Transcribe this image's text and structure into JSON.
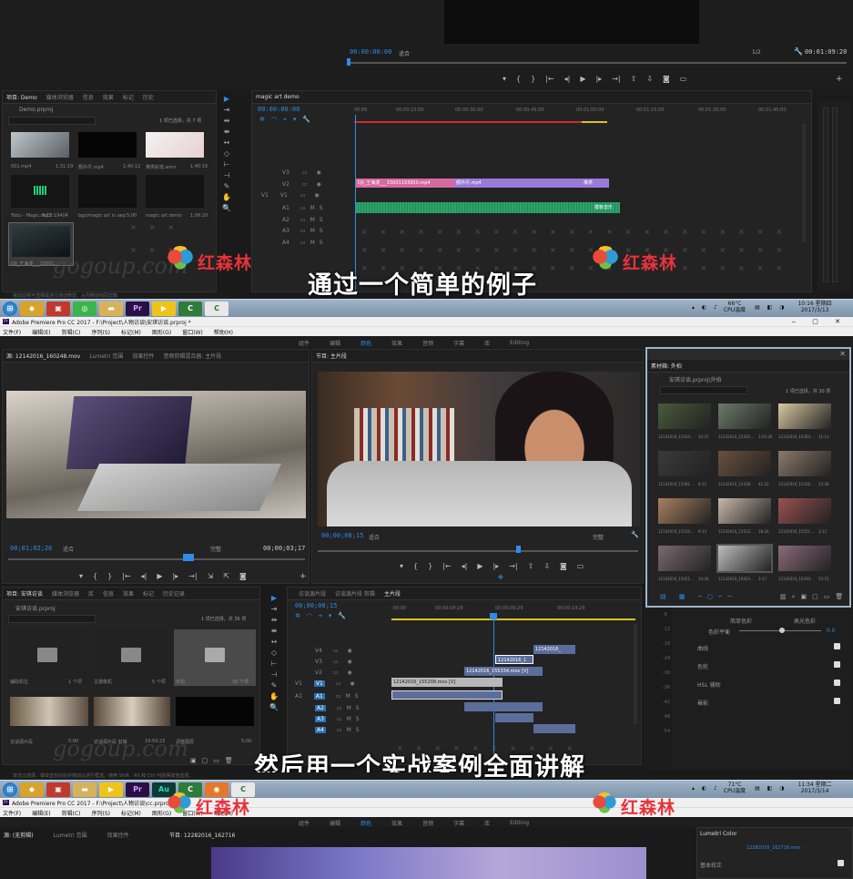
{
  "top": {
    "program_timecode_left": "00:00:00:00",
    "program_fit": "适合",
    "program_scale": "1/2",
    "program_timecode_right": "00:01:09:20",
    "project_tabs": [
      "项目: Demo",
      "媒体浏览器",
      "信息",
      "效果",
      "标记",
      "历史"
    ],
    "project_file": "Demo.prproj",
    "project_count": "1 项已选择，共 7 项",
    "project_items": [
      {
        "name": "001.mp4",
        "dur": "1:31:19"
      },
      {
        "name": "额外尽.mp4",
        "dur": "1:40:12"
      },
      {
        "name": "推类彩谱.wmv",
        "dur": "1:40:15"
      },
      {
        "name": "Tobu - Magic.mp3",
        "dur": "9:13:19404"
      },
      {
        "name": "bgo/magic art in.aep",
        "dur": "5:00"
      },
      {
        "name": "magic art demo",
        "dur": "1:09:20"
      },
      {
        "name": "DJI_王海波___15001...",
        "dur": ""
      }
    ],
    "seq_name": "magic art demo",
    "seq_timecode": "00:00:00:00",
    "ruler": [
      "00:00",
      "00:00:15:00",
      "00:00:30:00",
      "00:00:45:00",
      "00:01:00:00",
      "00:01:15:00",
      "00:01:30:00",
      "00:01:45:00"
    ],
    "tracks": [
      "V3",
      "V2",
      "V1",
      "A1",
      "A2",
      "A3",
      "A4"
    ],
    "clips": [
      "DJI_王海波___15001193950.mp4",
      "额外尽.mp4",
      "推类",
      "模板音乐"
    ],
    "subtitle": "通过一个简单的例子",
    "status": "拖动边缘可选择或进行滚动修改，从而移动线段剪辑"
  },
  "taskbar1": {
    "temp": "66°C",
    "cpu": "CPU温度",
    "time": "10:16 星期四",
    "date": "2017/3/13"
  },
  "mid": {
    "title": "Adobe Premiere Pro CC 2017 - F:\\Project\\人物访谈\\安琪访谈.prproj *",
    "menu": [
      "文件(F)",
      "编辑(E)",
      "剪辑(C)",
      "序列(S)",
      "标记(M)",
      "图形(G)",
      "窗口(W)",
      "帮助(H)"
    ],
    "workspaces": [
      "组件",
      "编辑",
      "颜色",
      "效果",
      "音频",
      "字幕",
      "库",
      "Editing"
    ],
    "source_tabs": [
      "源: 12142016_160248.mov",
      "Lumetri 范围",
      "效果控件",
      "音频剪辑混合器: 主片段"
    ],
    "source_tc": "00;01;02;26",
    "source_fit": "适合",
    "source_quality": "完整",
    "source_tc_right": "00;00;03;17",
    "program_tab": "节目: 主片段",
    "program_tc": "00;00;08;15",
    "program_fit": "适合",
    "program_quality": "完整",
    "bin_title": "素材箱: 外拍",
    "bin_path": "安琪访谈.prproj\\外拍",
    "bin_count": "1 项已选择，共 30 项",
    "bin_items": [
      {
        "name": "12142016_15434...",
        "dur": "10:27"
      },
      {
        "name": "12142016_15432...",
        "dur": "2:05:26"
      },
      {
        "name": "12142016_15454...",
        "dur": "11:13"
      },
      {
        "name": "12142016_15491...",
        "dur": "8:15"
      },
      {
        "name": "12142016_15438...",
        "dur": "42:22"
      },
      {
        "name": "12142016_15336...",
        "dur": "53:28"
      },
      {
        "name": "12142016_15510...",
        "dur": "9:13"
      },
      {
        "name": "12142016_15513...",
        "dur": "18:24"
      },
      {
        "name": "12142016_15551...",
        "dur": "3:12"
      },
      {
        "name": "12142016_15021...",
        "dur": "14:26"
      },
      {
        "name": "12142016_16024...",
        "dur": "3:17"
      },
      {
        "name": "12142016_16240...",
        "dur": "15:15"
      }
    ],
    "project_tabs": [
      "项目: 安琪访谈",
      "媒体浏览器",
      "库",
      "信息",
      "效果",
      "标记",
      "历史记录"
    ],
    "project_file": "安琪访谈.prproj",
    "project_count": "1 项已选择，共 36 项",
    "project_items": [
      {
        "name": "辅助机位",
        "meta": "1 个项"
      },
      {
        "name": "主摄像机",
        "meta": "5 个项"
      },
      {
        "name": "外拍",
        "meta": "30 个项"
      },
      {
        "name": "访谈源片段",
        "meta": "5:00"
      },
      {
        "name": "访谈源片段 剪辑",
        "meta": "19:50:23"
      },
      {
        "name": "调整图层",
        "meta": "5:00"
      }
    ],
    "timeline_tabs": [
      "访谈源片段",
      "访谈源片段 剪辑",
      "主片段"
    ],
    "timeline_tc": "00;00;08;15",
    "timeline_ruler": [
      ";00;00",
      "00;00;04;29",
      "00;00;09;29",
      "00;00;14;29"
    ],
    "tracks": [
      "V4",
      "V3",
      "V2",
      "V1",
      "A1",
      "A2",
      "A3",
      "A4"
    ],
    "clips": [
      "12142016_",
      "12142016_1",
      "12142016_155334.mov [V]",
      "12142016_155208.mov [V]"
    ],
    "lumetri": {
      "labels": [
        "简单色彩",
        "高光色彩",
        "色彩平衡",
        "曲线",
        "色轮",
        "HSL 辅助",
        "晕影"
      ],
      "balance_value": "0.0"
    },
    "subtitle": "然后用一个实战案例全面讲解",
    "status": "单击以选择，或单击空白处并拖动以进行框选。使用 Shift、Alt 和 Ctrl 可获得其他选项。"
  },
  "taskbar2": {
    "temp": "71°C",
    "cpu": "CPU温度",
    "time": "11:34 星期二",
    "date": "2017/3/14"
  },
  "bottom": {
    "title": "Adobe Premiere Pro CC 2017 - F:\\Project\\人物访谈\\cc.prproj *",
    "menu": [
      "文件(F)",
      "编辑(E)",
      "剪辑(C)",
      "序列(S)",
      "标记(M)",
      "图形(G)",
      "窗口(W)",
      "帮助(H)"
    ],
    "workspaces": [
      "组件",
      "编辑",
      "颜色",
      "效果",
      "音频",
      "字幕",
      "库",
      "Editing"
    ],
    "source_tabs": [
      "源: (无剪辑)",
      "Lumetri 范围",
      "效果控件"
    ],
    "program_tab": "节目: 12282016_162716",
    "lumetri_tab": "Lumetri Color",
    "lumetri_clip": "12282016_162716.mov",
    "lumetri_basic": "基本校正"
  },
  "brand": {
    "watermark": "gogoup.com",
    "logo": "红森林"
  },
  "colors": {
    "accent": "#2d8ceb",
    "timeline_green": "#2da56a",
    "timeline_purple": "#9a7ad8",
    "timeline_pink": "#d66aa0",
    "logo_red": "#e8323c"
  }
}
